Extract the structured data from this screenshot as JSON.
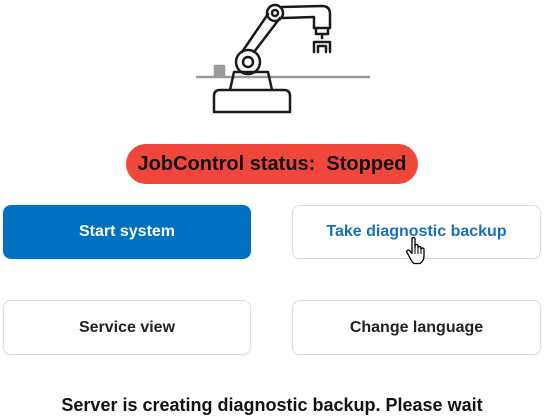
{
  "app": {
    "illustration": "industrial-robot-arm-icon"
  },
  "status": {
    "text": "JobControl status:  Stopped",
    "color": "#f0463c"
  },
  "buttons": {
    "start_system": "Start system",
    "diagnostic_backup": "Take diagnostic backup",
    "service_view": "Service view",
    "change_language": "Change language"
  },
  "colors": {
    "primary": "#0070c0",
    "accent_text": "#1a6fb8"
  },
  "cursor": {
    "icon": "hand-pointer-icon"
  },
  "message": {
    "text": "Server is creating diagnostic backup. Please wait"
  }
}
